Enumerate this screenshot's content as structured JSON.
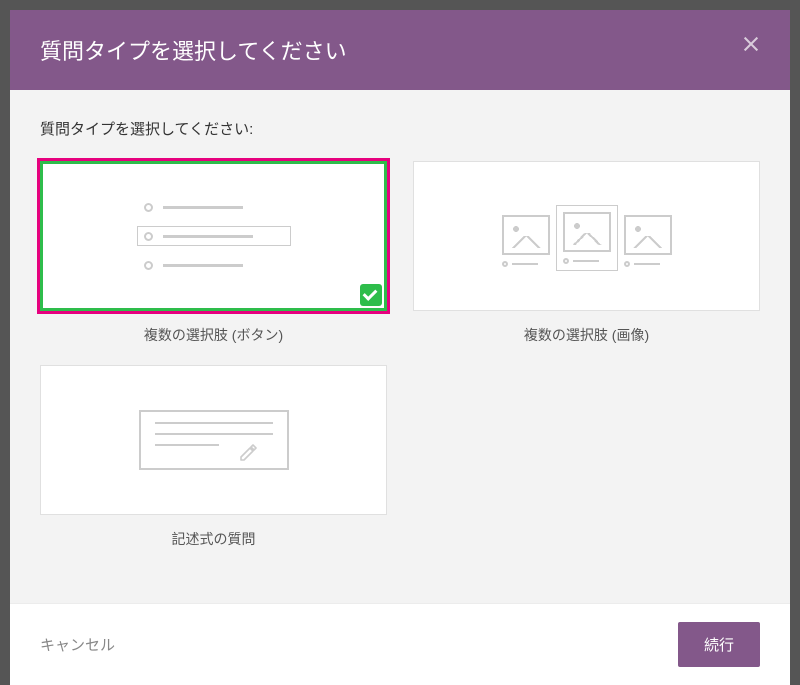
{
  "header": {
    "title": "質問タイプを選択してください"
  },
  "body": {
    "prompt": "質問タイプを選択してください:",
    "options": [
      {
        "id": "multiple-choice-button",
        "label": "複数の選択肢 (ボタン)",
        "selected": true,
        "highlighted": true
      },
      {
        "id": "multiple-choice-image",
        "label": "複数の選択肢 (画像)",
        "selected": false,
        "highlighted": false
      },
      {
        "id": "essay",
        "label": "記述式の質問",
        "selected": false,
        "highlighted": false
      }
    ]
  },
  "footer": {
    "cancel": "キャンセル",
    "continue": "続行"
  },
  "colors": {
    "accent": "#83588a",
    "selected": "#2ebd4b",
    "highlight": "#e6007e"
  }
}
